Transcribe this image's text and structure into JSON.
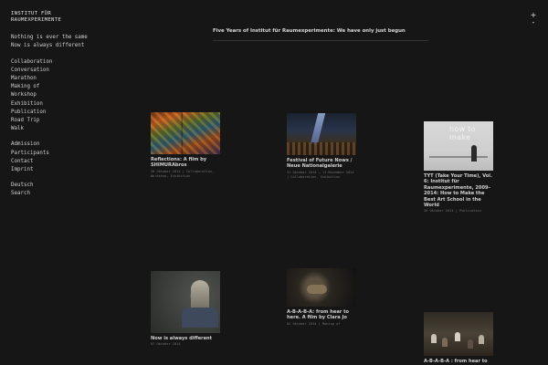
{
  "site": {
    "title": "INSTITUT FÜR\nRAUMEXPERIMENTE",
    "nav_groups": [
      [
        "Nothing is ever the same",
        "Now is always different"
      ],
      [
        "Collaboration",
        "Conversation",
        "Marathon",
        "Making of",
        "Workshop",
        "Exhibition",
        "Publication",
        "Road Trip",
        "Walk"
      ],
      [
        "Admission",
        "Participants",
        "Contact",
        "Imprint"
      ],
      [
        "Deutsch",
        "Search"
      ]
    ]
  },
  "zoom": {
    "plus": "+",
    "minus": "-"
  },
  "headline": "Five Years of Institut für Raumexperimente: We have only just begun",
  "cards": [
    {
      "title": "Reflections: A film by SHIMURAbros",
      "meta": "30 Oktober 2014 | Collaboration, Workshop, Exhibition"
    },
    {
      "title": "Festival of Future Nows / Neue Nationalgalerie",
      "meta": "31 Oktober 2014 – 11 November 2014 | Collaboration, Exhibition"
    },
    {
      "title": "TYT (Take Your Time), Vol. 6: Institut für Raumexperimente, 2009–2014: How to Make the Best Art School in the World",
      "meta": "26 Oktober 2014 | Publication",
      "thumb_text": "how to make"
    },
    {
      "title": "Now is always different",
      "meta": "07 Oktober 2014"
    },
    {
      "title": "A-B-A-B-A: from hear to here. A film by Clara Jo",
      "meta": "02 Oktober 2014 | Making of"
    },
    {
      "title": "A-B-A-B-A : from hear to",
      "meta": ""
    }
  ]
}
